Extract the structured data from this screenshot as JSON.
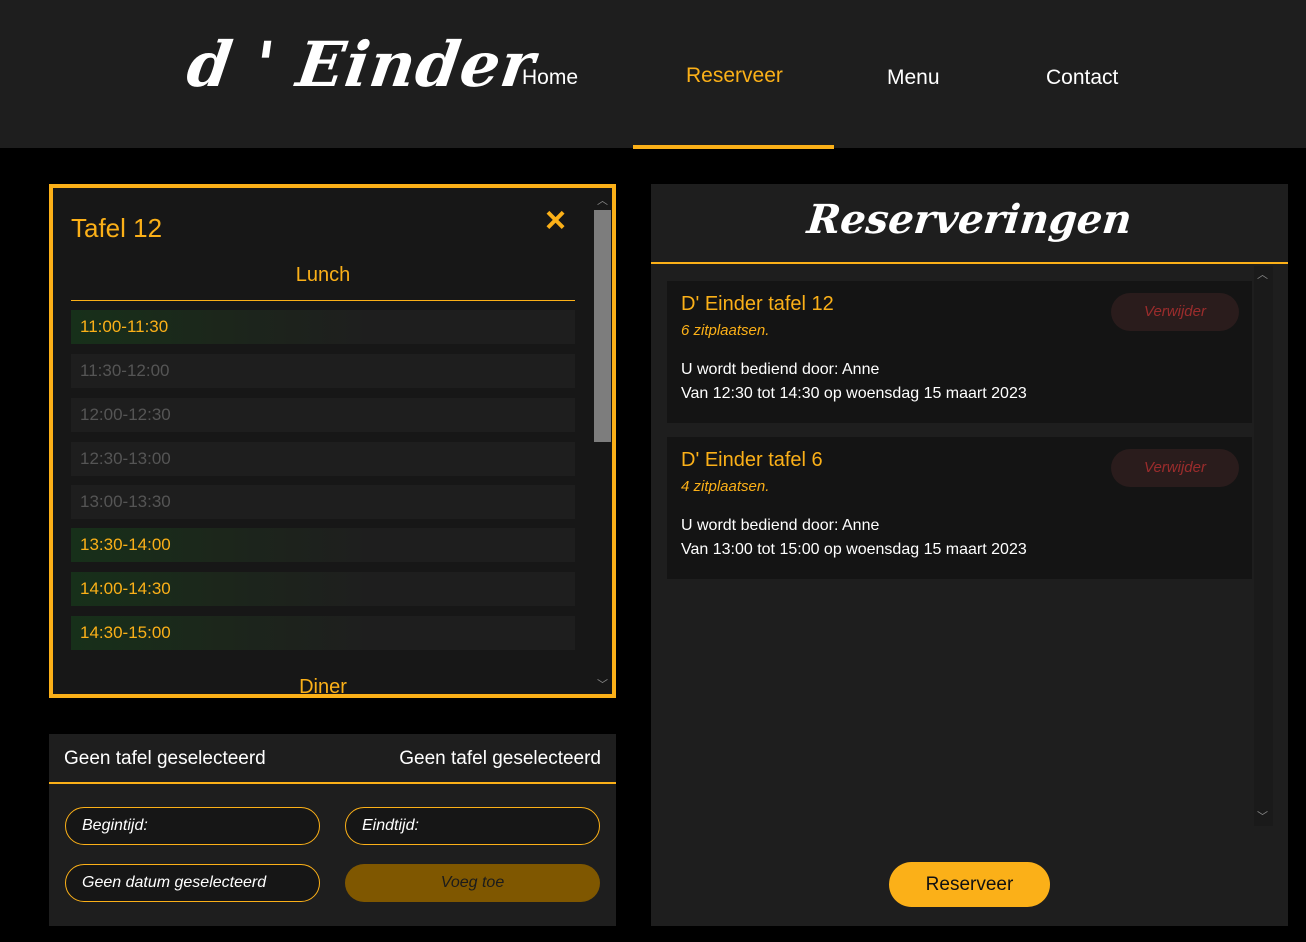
{
  "header": {
    "logo": "d ' Einder",
    "nav": [
      {
        "label": "Home"
      },
      {
        "label": "Reserveer"
      },
      {
        "label": "Menu"
      },
      {
        "label": "Contact"
      }
    ],
    "active_nav": "Reserveer",
    "accent_color": "#fbb018"
  },
  "table_panel": {
    "title": "Tafel 12",
    "close_icon": "×",
    "lunch_label": "Lunch",
    "diner_label": "Diner",
    "slots": [
      {
        "label": "11:00-11:30",
        "available": true
      },
      {
        "label": "11:30-12:00",
        "available": false
      },
      {
        "label": "12:00-12:30",
        "available": false
      },
      {
        "label": "12:30-13:00",
        "available": false
      },
      {
        "label": "13:00-13:30",
        "available": false
      },
      {
        "label": "13:30-14:00",
        "available": true
      },
      {
        "label": "14:00-14:30",
        "available": true
      },
      {
        "label": "14:30-15:00",
        "available": true
      }
    ]
  },
  "form_panel": {
    "left_status": "Geen tafel geselecteerd",
    "right_status": "Geen tafel geselecteerd",
    "begin_label": "Begintijd:",
    "end_label": "Eindtijd:",
    "date_label": "Geen datum geselecteerd",
    "add_button": "Voeg toe"
  },
  "reservations": {
    "title": "Reserveringen",
    "items": [
      {
        "title": "D' Einder tafel 12",
        "seats": "6 zitplaatsen.",
        "waiter": "U wordt bediend door: Anne",
        "when": "Van 12:30 tot 14:30 op woensdag 15 maart 2023",
        "delete_label": "Verwijder"
      },
      {
        "title": "D' Einder tafel 6",
        "seats": "4 zitplaatsen.",
        "waiter": "U wordt bediend door: Anne",
        "when": "Van 13:00 tot 15:00 op woensdag 15 maart 2023",
        "delete_label": "Verwijder"
      }
    ],
    "reserve_button": "Reserveer"
  }
}
